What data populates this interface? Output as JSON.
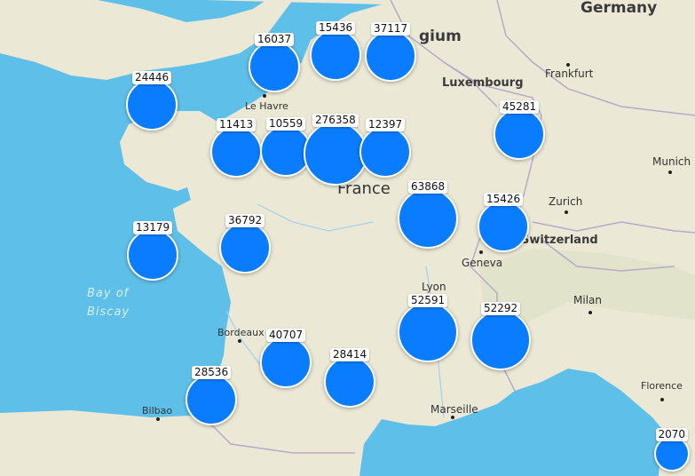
{
  "map": {
    "colors": {
      "sea": "#5ec0e8",
      "land": "#ebe8d5",
      "cluster": "#0a7cff",
      "cluster_border": "#ffffff"
    },
    "countries": {
      "germany": "Germany",
      "belgium": "gium",
      "luxembourg": "Luxembourg",
      "france": "France",
      "switzerland": "Switzerland"
    },
    "cities": {
      "frankfurt": "Frankfurt",
      "le_havre": "Le Havre",
      "munich": "Munich",
      "zurich": "Zurich",
      "geneva": "Geneva",
      "lyon": "Lyon",
      "milan": "Milan",
      "bordeaux": "Bordeaux",
      "bilbao": "Bilbao",
      "marseille": "Marseille",
      "florence": "Florence"
    },
    "sea_labels": {
      "bay_line1": "Bay of",
      "bay_line2": "Biscay"
    },
    "clusters": [
      {
        "id": "c1",
        "count": "16037"
      },
      {
        "id": "c2",
        "count": "15436"
      },
      {
        "id": "c3",
        "count": "37117"
      },
      {
        "id": "c4",
        "count": "24446"
      },
      {
        "id": "c5",
        "count": "11413"
      },
      {
        "id": "c6",
        "count": "10559"
      },
      {
        "id": "c7",
        "count": "276358"
      },
      {
        "id": "c8",
        "count": "12397"
      },
      {
        "id": "c9",
        "count": "45281"
      },
      {
        "id": "c10",
        "count": "63868"
      },
      {
        "id": "c11",
        "count": "15426"
      },
      {
        "id": "c12",
        "count": "13179"
      },
      {
        "id": "c13",
        "count": "36792"
      },
      {
        "id": "c14",
        "count": "52591"
      },
      {
        "id": "c15",
        "count": "52292"
      },
      {
        "id": "c16",
        "count": "40707"
      },
      {
        "id": "c17",
        "count": "28414"
      },
      {
        "id": "c18",
        "count": "28536"
      },
      {
        "id": "c19",
        "count": "2070"
      }
    ]
  }
}
